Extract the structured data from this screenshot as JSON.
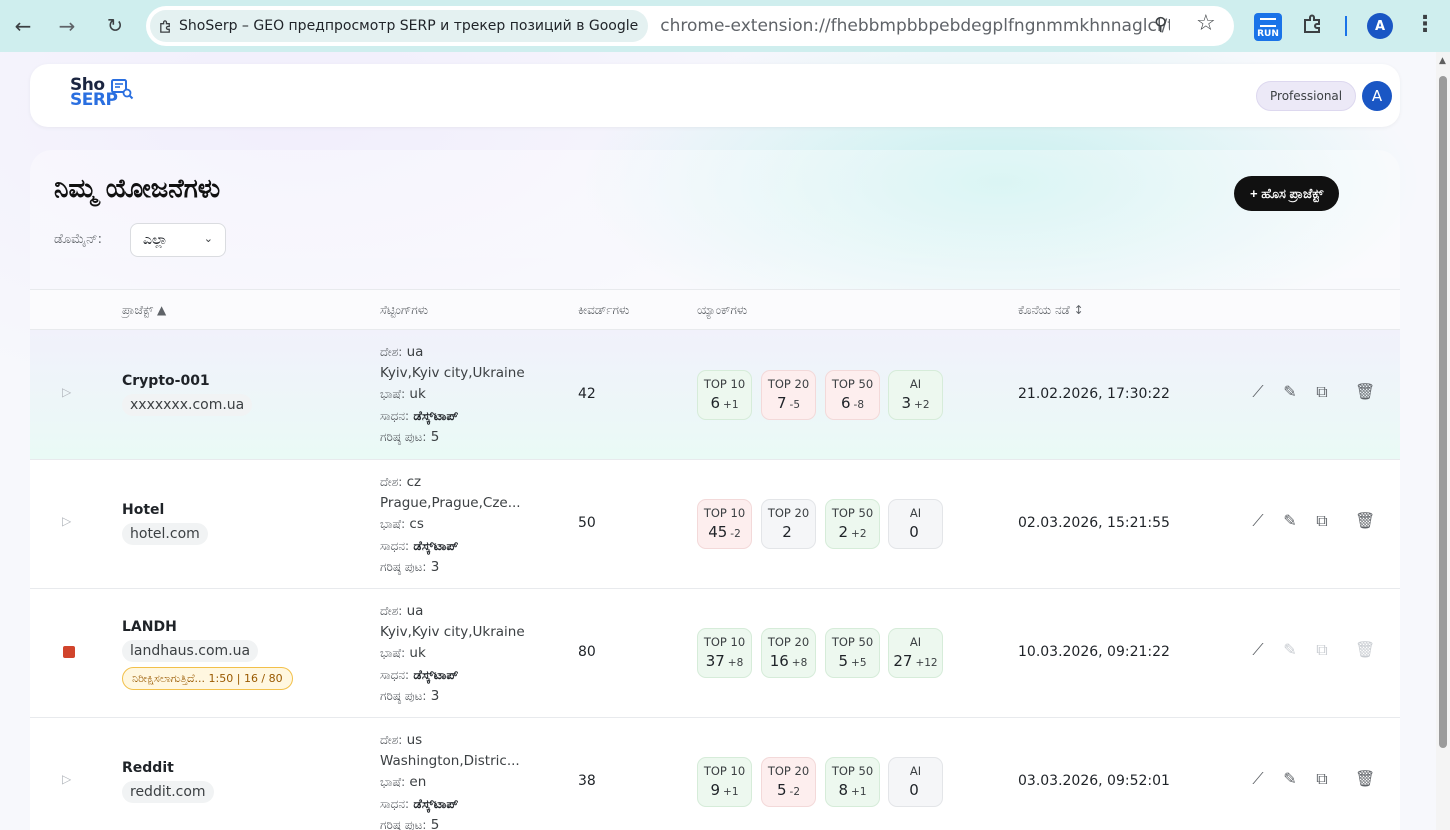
{
  "browser": {
    "tab_title": "ShoSerp – GEO предпросмотр SERP и трекер позиций в Google",
    "url": "chrome-extension://fhebbmpbbpebdegplfngnmmkhnnaglcl/tr...",
    "run_label": "RUN",
    "profile_initial": "A"
  },
  "header": {
    "logo_line1": "Sho",
    "logo_line2": "SERP",
    "plan": "Professional",
    "avatar": "A"
  },
  "main": {
    "title": "ನಿಮ್ಮ ಯೋಜನೆಗಳು",
    "domain_label": "ಡೊಮೈನ್:",
    "domain_value": "ಎಲ್ಲಾ",
    "new_project": "+ ಹೊಸ ಪ್ರಾಜೆಕ್ಟ್"
  },
  "table": {
    "headers": {
      "project": "ಪ್ರಾಜೆಕ್ಟ್ ▲",
      "settings": "ಸೆಟ್ಟಿಂಗ್‌ಗಳು",
      "keywords": "ಕೀವರ್ಡ್‌ಗಳು",
      "rankings": "ಯ್ಯಾಂಕ್‌ಗಳು",
      "last_run": "ಕೊನೆಯ ನಡೆ ↕"
    },
    "settings_labels": {
      "country": "ದೇಶ:",
      "language": "ಭಾಷೆ:",
      "device": "ಸಾಧನ:",
      "max_pages": "ಗರಿಷ್ಠ ಪುಟ:"
    },
    "rank_labels": [
      "TOP 10",
      "TOP 20",
      "TOP 50",
      "AI"
    ],
    "rows": [
      {
        "name": "Crypto-001",
        "domain": "xxxxxxx.com.ua",
        "country": "ua",
        "location": "Kyiv,Kyiv city,Ukraine",
        "language": "uk",
        "device": "ಡೆಸ್ಕ್‌ಟಾಪ್",
        "max_pages": "5",
        "keywords": "42",
        "ranks": [
          {
            "value": "6",
            "delta": "+1",
            "trend": "up"
          },
          {
            "value": "7",
            "delta": "-5",
            "trend": "down"
          },
          {
            "value": "6",
            "delta": "-8",
            "trend": "down"
          },
          {
            "value": "3",
            "delta": "+2",
            "trend": "up"
          }
        ],
        "last_run": "21.02.2026, 17:30:22"
      },
      {
        "name": "Hotel",
        "domain": "hotel.com",
        "country": "cz",
        "location": "Prague,Prague,Cze...",
        "language": "cs",
        "device": "ಡೆಸ್ಕ್‌ಟಾಪ್",
        "max_pages": "3",
        "keywords": "50",
        "ranks": [
          {
            "value": "45",
            "delta": "-2",
            "trend": "down"
          },
          {
            "value": "2",
            "delta": "",
            "trend": "flat"
          },
          {
            "value": "2",
            "delta": "+2",
            "trend": "up"
          },
          {
            "value": "0",
            "delta": "",
            "trend": "flat"
          }
        ],
        "last_run": "02.03.2026, 15:21:55"
      },
      {
        "name": "LANDH",
        "domain": "landhaus.com.ua",
        "progress": "ನಿರೀಕ್ಷಿಸಲಾಗುತ್ತಿದೆ... 1:50  |  16 / 80",
        "country": "ua",
        "location": "Kyiv,Kyiv city,Ukraine",
        "language": "uk",
        "device": "ಡೆಸ್ಕ್‌ಟಾಪ್",
        "max_pages": "3",
        "keywords": "80",
        "ranks": [
          {
            "value": "37",
            "delta": "+8",
            "trend": "up"
          },
          {
            "value": "16",
            "delta": "+8",
            "trend": "up"
          },
          {
            "value": "5",
            "delta": "+5",
            "trend": "up"
          },
          {
            "value": "27",
            "delta": "+12",
            "trend": "up"
          }
        ],
        "last_run": "10.03.2026, 09:21:22"
      },
      {
        "name": "Reddit",
        "domain": "reddit.com",
        "country": "us",
        "location": "Washington,Distric...",
        "language": "en",
        "device": "ಡೆಸ್ಕ್‌ಟಾಪ್",
        "max_pages": "5",
        "keywords": "38",
        "ranks": [
          {
            "value": "9",
            "delta": "+1",
            "trend": "up"
          },
          {
            "value": "5",
            "delta": "-2",
            "trend": "down"
          },
          {
            "value": "8",
            "delta": "+1",
            "trend": "up"
          },
          {
            "value": "0",
            "delta": "",
            "trend": "flat"
          }
        ],
        "last_run": "03.03.2026, 09:52:01"
      }
    ]
  }
}
